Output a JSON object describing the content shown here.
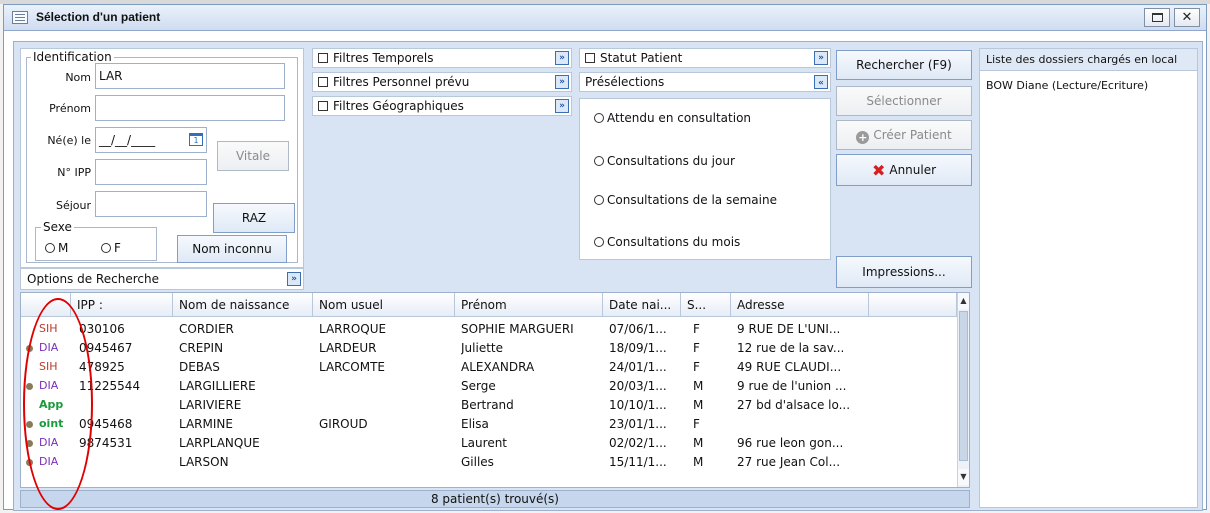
{
  "window": {
    "title": "Sélection d'un patient"
  },
  "ident": {
    "legend": "Identification",
    "nom_label": "Nom",
    "nom_value": "LAR",
    "prenom_label": "Prénom",
    "ne_label": "Né(e) le",
    "ne_value": "__/__/____",
    "ipp_label": "N° IPP",
    "sejour_label": "Séjour",
    "vitale_btn": "Vitale",
    "raz_btn": "RAZ",
    "sexe_legend": "Sexe",
    "sexe_m": "M",
    "sexe_f": "F",
    "nom_inconnu_btn": "Nom inconnu"
  },
  "options_label": "Options de Recherche",
  "filters": {
    "temporels": "Filtres Temporels",
    "personnel": "Filtres Personnel prévu",
    "geographiques": "Filtres Géographiques",
    "statut": "Statut Patient",
    "preselections": "Présélections"
  },
  "preselections": [
    "Attendu en consultation",
    "Consultations du jour",
    "Consultations de la semaine",
    "Consultations du mois"
  ],
  "actions": {
    "rechercher": "Rechercher (F9)",
    "selectionner": "Sélectionner",
    "creer": "Créer Patient",
    "annuler": "Annuler",
    "impressions": "Impressions..."
  },
  "local": {
    "header": "Liste des dossiers chargés en local",
    "item": "BOW  Diane  (Lecture/Ecriture)"
  },
  "grid": {
    "headers": [
      "IPP :",
      "Nom de naissance",
      "Nom usuel",
      "Prénom",
      "Date nai...",
      "S...",
      "Adresse"
    ],
    "rows": [
      {
        "src": "SIH",
        "ipp": "030106",
        "nom": "CORDIER",
        "usuel": "LARROQUE",
        "prenom": "SOPHIE MARGUERI",
        "date": "07/06/1...",
        "sexe": "F",
        "adresse": "9 RUE DE L'UNI..."
      },
      {
        "src": "DIA",
        "ipp": "0945467",
        "nom": "CREPIN",
        "usuel": "LARDEUR",
        "prenom": "Juliette",
        "date": "18/09/1...",
        "sexe": "F",
        "adresse": "12 rue de la sav..."
      },
      {
        "src": "SIH",
        "ipp": "478925",
        "nom": "DEBAS",
        "usuel": "LARCOMTE",
        "prenom": "ALEXANDRA",
        "date": "24/01/1...",
        "sexe": "F",
        "adresse": "49 RUE CLAUDI..."
      },
      {
        "src": "DIA",
        "ipp": "11225544",
        "nom": "LARGILLIERE",
        "usuel": "",
        "prenom": "Serge",
        "date": "20/03/1...",
        "sexe": "M",
        "adresse": "9 rue de l'union ..."
      },
      {
        "src": "App",
        "ipp": "",
        "nom": "LARIVIERE",
        "usuel": "",
        "prenom": "Bertrand",
        "date": "10/10/1...",
        "sexe": "M",
        "adresse": "27 bd d'alsace lo..."
      },
      {
        "src": "oint",
        "ipp": "0945468",
        "nom": "LARMINE",
        "usuel": "GIROUD",
        "prenom": "Elisa",
        "date": "23/01/1...",
        "sexe": "F",
        "adresse": ""
      },
      {
        "src": "DIA",
        "ipp": "9874531",
        "nom": "LARPLANQUE",
        "usuel": "",
        "prenom": "Laurent",
        "date": "02/02/1...",
        "sexe": "M",
        "adresse": "96 rue leon gon..."
      },
      {
        "src": "DIA",
        "ipp": "",
        "nom": "LARSON",
        "usuel": "",
        "prenom": "Gilles",
        "date": "15/11/1...",
        "sexe": "M",
        "adresse": "27 rue Jean Col..."
      }
    ]
  },
  "status": "8 patient(s) trouvé(s)",
  "colors": {
    "sih": "#c0392b",
    "dia": "#7a2fb8",
    "app": "#1a9a3a",
    "accent": "#3a6fb5"
  }
}
